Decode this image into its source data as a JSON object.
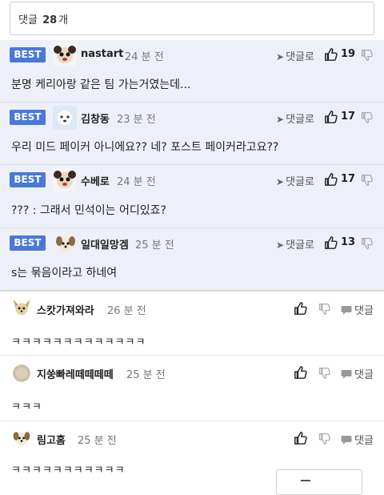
{
  "comments_header": {
    "label": "댓글",
    "count": "28",
    "unit": "개"
  },
  "best_badge": "BEST",
  "reply_label": "댓글로",
  "reply_chat_label": "댓글",
  "accent": "#4a78d8",
  "best_comments": [
    {
      "user": "nastart",
      "time": "24 분 전",
      "likes": "19",
      "text": "분명 케리아랑 같은 팀 가는거였는데..."
    },
    {
      "user": "김창동",
      "time": "23 분 전",
      "likes": "17",
      "text": "우리 미드 페이커 아니에요?? 네? 포스트 페이커라고요??"
    },
    {
      "user": "수베로",
      "time": "24 분 전",
      "likes": "17",
      "text": "??? : 그래서 민석이는 어디있죠?"
    },
    {
      "user": "일대일망겜",
      "time": "25 분 전",
      "likes": "13",
      "text": "s는 묶음이라고 하네여"
    }
  ],
  "comments": [
    {
      "user": "스캇가져와라",
      "time": "26 분 전",
      "text": "ㅋㅋㅋㅋㅋㅋㅋㅋㅋㅋㅋㅋㅋ"
    },
    {
      "user": "지쑹빠레떼떼떼떼",
      "time": "25 분 전",
      "text": "ㅋㅋㅋ"
    },
    {
      "user": "림고홈",
      "time": "25 분 전",
      "text": "ㅋㅋㅋㅋㅋㅋㅋㅋㅋㅋㅋ"
    }
  ]
}
